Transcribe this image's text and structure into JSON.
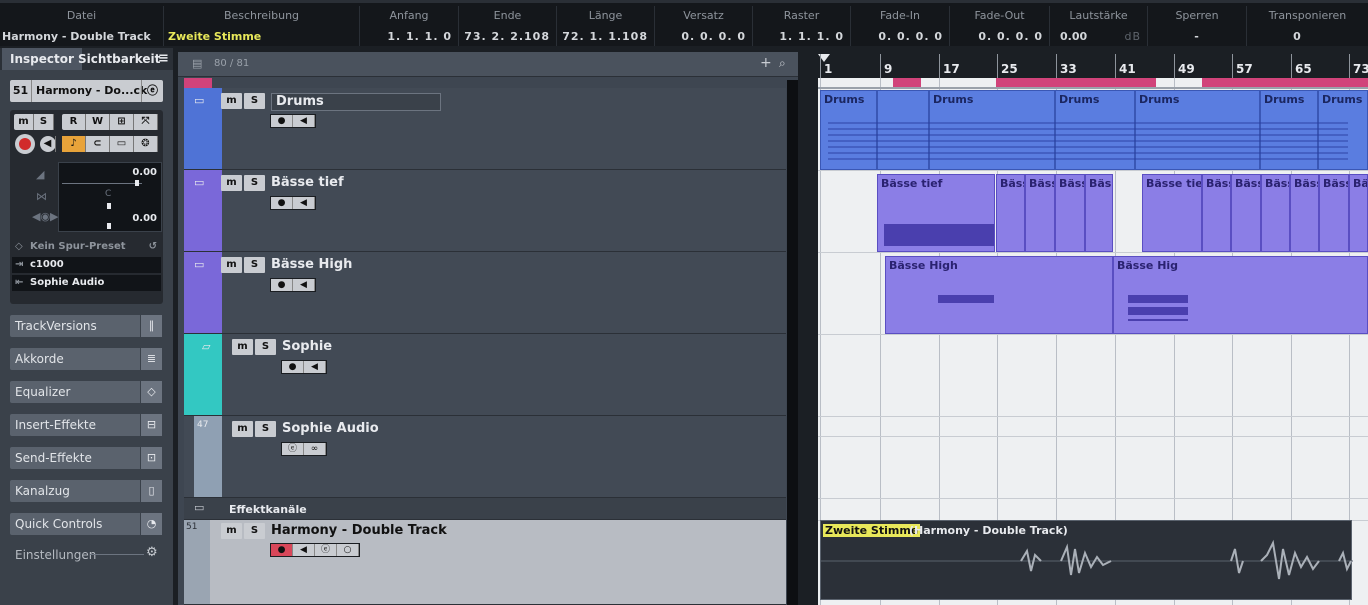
{
  "infoline": {
    "columns": [
      {
        "header": "Datei",
        "value": "Harmony - Double Track"
      },
      {
        "header": "Beschreibung",
        "value": "Zweite Stimme"
      },
      {
        "header": "Anfang",
        "value": "1. 1. 1.   0"
      },
      {
        "header": "Ende",
        "value": "73. 2. 2.108"
      },
      {
        "header": "Länge",
        "value": "72. 1. 1.108"
      },
      {
        "header": "Versatz",
        "value": "0. 0. 0.   0"
      },
      {
        "header": "Raster",
        "value": "1. 1. 1.   0"
      },
      {
        "header": "Fade-In",
        "value": "0. 0. 0.   0"
      },
      {
        "header": "Fade-Out",
        "value": "0. 0. 0.   0"
      },
      {
        "header": "Lautstärke",
        "value": "0.00",
        "unit": "dB"
      },
      {
        "header": "Sperren",
        "value": "-"
      },
      {
        "header": "Transponieren",
        "value": "0"
      }
    ]
  },
  "inspector": {
    "tab_inspector": "Inspector",
    "tab_visibility": "Sichtbarkeit",
    "track_number": "51",
    "track_name": "Harmony - Do...ck",
    "volume": "0.00",
    "pan": "C",
    "delay": "0.00",
    "preset": "Kein Spur-Preset",
    "input": "c1000",
    "output": "Sophie Audio",
    "sections": [
      "TrackVersions",
      "Akkorde",
      "Equalizer",
      "Insert-Effekte",
      "Send-Effekte",
      "Kanalzug",
      "Quick Controls"
    ],
    "settings": "Einstellungen"
  },
  "tracklist": {
    "count": "80 / 81",
    "tracks": [
      {
        "name": "Drums",
        "color": "#4f73d6"
      },
      {
        "name": "Bässe tief",
        "color": "#7a68d9"
      },
      {
        "name": "Bässe High",
        "color": "#7a68d9"
      },
      {
        "name": "Sophie",
        "color": "#33c8c2"
      },
      {
        "name": "Sophie Audio",
        "number": "47",
        "color": "#8fa0b3"
      },
      {
        "name": "Effektkanäle"
      },
      {
        "name": "Harmony - Double Track",
        "number": "51"
      }
    ]
  },
  "ruler": {
    "bars": [
      "1",
      "9",
      "17",
      "25",
      "33",
      "41",
      "49",
      "57",
      "65",
      "73"
    ]
  },
  "events": {
    "drums": [
      "Drums",
      "Drums",
      "Drums",
      "Drums",
      "Drums",
      "Drums"
    ],
    "bass_tief": [
      "Bässe tief",
      "Bäss",
      "Bäss",
      "Bäss",
      "Bäss",
      "Bässe tief",
      "Bäss",
      "Bäss",
      "Bäss",
      "Bäss",
      "Bäss",
      "Bäs"
    ],
    "bass_high": [
      "Bässe High",
      "Bässe Hig"
    ],
    "audio_desc": "Zweite Stimme",
    "audio_track": "(Harmony - Double Track)"
  }
}
